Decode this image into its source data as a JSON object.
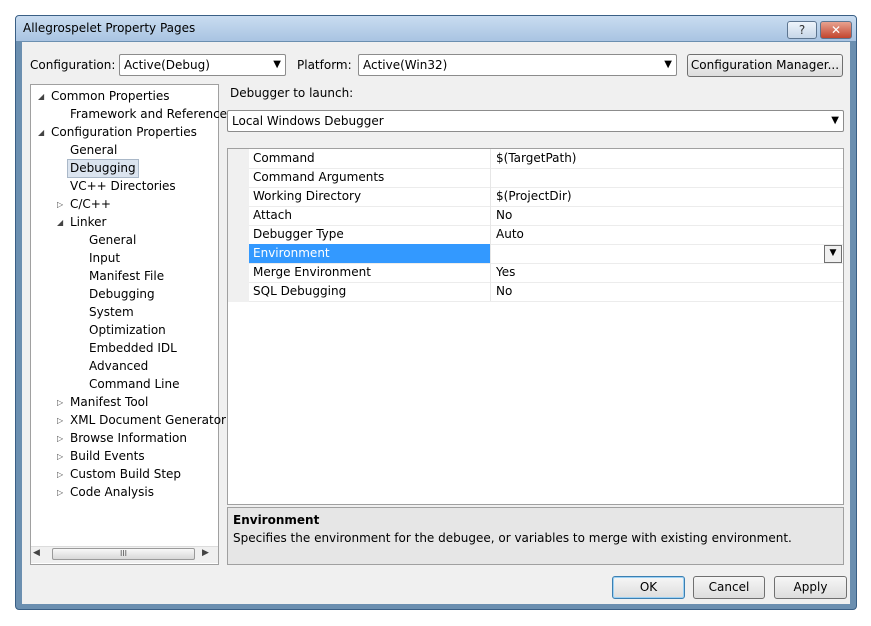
{
  "window": {
    "title": "Allegrospelet Property Pages",
    "help_glyph": "?",
    "close_glyph": "✕"
  },
  "toolbar": {
    "configuration_label": "Configuration:",
    "configuration_value": "Active(Debug)",
    "platform_label": "Platform:",
    "platform_value": "Active(Win32)",
    "config_manager_label": "Configuration Manager..."
  },
  "tree": {
    "expanded_glyph": "◢",
    "collapsed_glyph": "▷",
    "items": [
      {
        "label": "Common Properties",
        "expander": "expanded"
      },
      {
        "label": "Framework and References",
        "expander": "none"
      },
      {
        "label": "Configuration Properties",
        "expander": "expanded"
      },
      {
        "label": "General",
        "expander": "none"
      },
      {
        "label": "Debugging",
        "expander": "none",
        "selected": true
      },
      {
        "label": "VC++ Directories",
        "expander": "none"
      },
      {
        "label": "C/C++",
        "expander": "collapsed"
      },
      {
        "label": "Linker",
        "expander": "expanded"
      },
      {
        "label": "General",
        "expander": "none"
      },
      {
        "label": "Input",
        "expander": "none"
      },
      {
        "label": "Manifest File",
        "expander": "none"
      },
      {
        "label": "Debugging",
        "expander": "none"
      },
      {
        "label": "System",
        "expander": "none"
      },
      {
        "label": "Optimization",
        "expander": "none"
      },
      {
        "label": "Embedded IDL",
        "expander": "none"
      },
      {
        "label": "Advanced",
        "expander": "none"
      },
      {
        "label": "Command Line",
        "expander": "none"
      },
      {
        "label": "Manifest Tool",
        "expander": "collapsed"
      },
      {
        "label": "XML Document Generator",
        "expander": "collapsed"
      },
      {
        "label": "Browse Information",
        "expander": "collapsed"
      },
      {
        "label": "Build Events",
        "expander": "collapsed"
      },
      {
        "label": "Custom Build Step",
        "expander": "collapsed"
      },
      {
        "label": "Code Analysis",
        "expander": "collapsed"
      }
    ],
    "scroll_left_glyph": "◀",
    "scroll_right_glyph": "▶",
    "scroll_thumb_glyph": "III"
  },
  "debugger": {
    "launch_label": "Debugger to launch:",
    "launch_value": "Local Windows Debugger"
  },
  "properties": [
    {
      "name": "Command",
      "value": "$(TargetPath)"
    },
    {
      "name": "Command Arguments",
      "value": ""
    },
    {
      "name": "Working Directory",
      "value": "$(ProjectDir)"
    },
    {
      "name": "Attach",
      "value": "No"
    },
    {
      "name": "Debugger Type",
      "value": "Auto"
    },
    {
      "name": "Environment",
      "value": "",
      "selected": true
    },
    {
      "name": "Merge Environment",
      "value": "Yes"
    },
    {
      "name": "SQL Debugging",
      "value": "No"
    }
  ],
  "description": {
    "title": "Environment",
    "text": "Specifies the environment for the debugee, or variables to merge with existing environment."
  },
  "buttons": {
    "ok": "OK",
    "cancel": "Cancel",
    "apply": "Apply"
  },
  "icons": {
    "dropdown_arrow": "▼"
  }
}
